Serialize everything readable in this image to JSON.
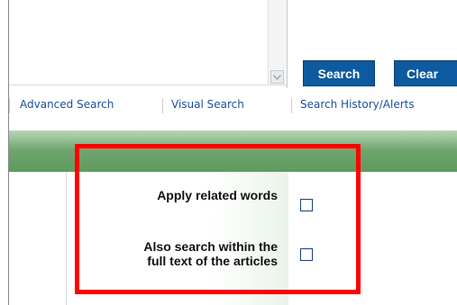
{
  "query": {
    "text": ""
  },
  "buttons": {
    "search": "Search",
    "clear": "Clear"
  },
  "links": [
    "Advanced Search",
    "Visual Search",
    "Search History/Alerts"
  ],
  "options": {
    "related_words": {
      "label": "Apply related words",
      "checked": false
    },
    "full_text": {
      "label_line1": "Also search within the",
      "label_line2": "full text of the articles",
      "checked": false
    }
  },
  "colors": {
    "button": "#0d5aa0",
    "band": "#6fa56e",
    "highlight": "#ff0000",
    "link": "#1b4f9c"
  }
}
